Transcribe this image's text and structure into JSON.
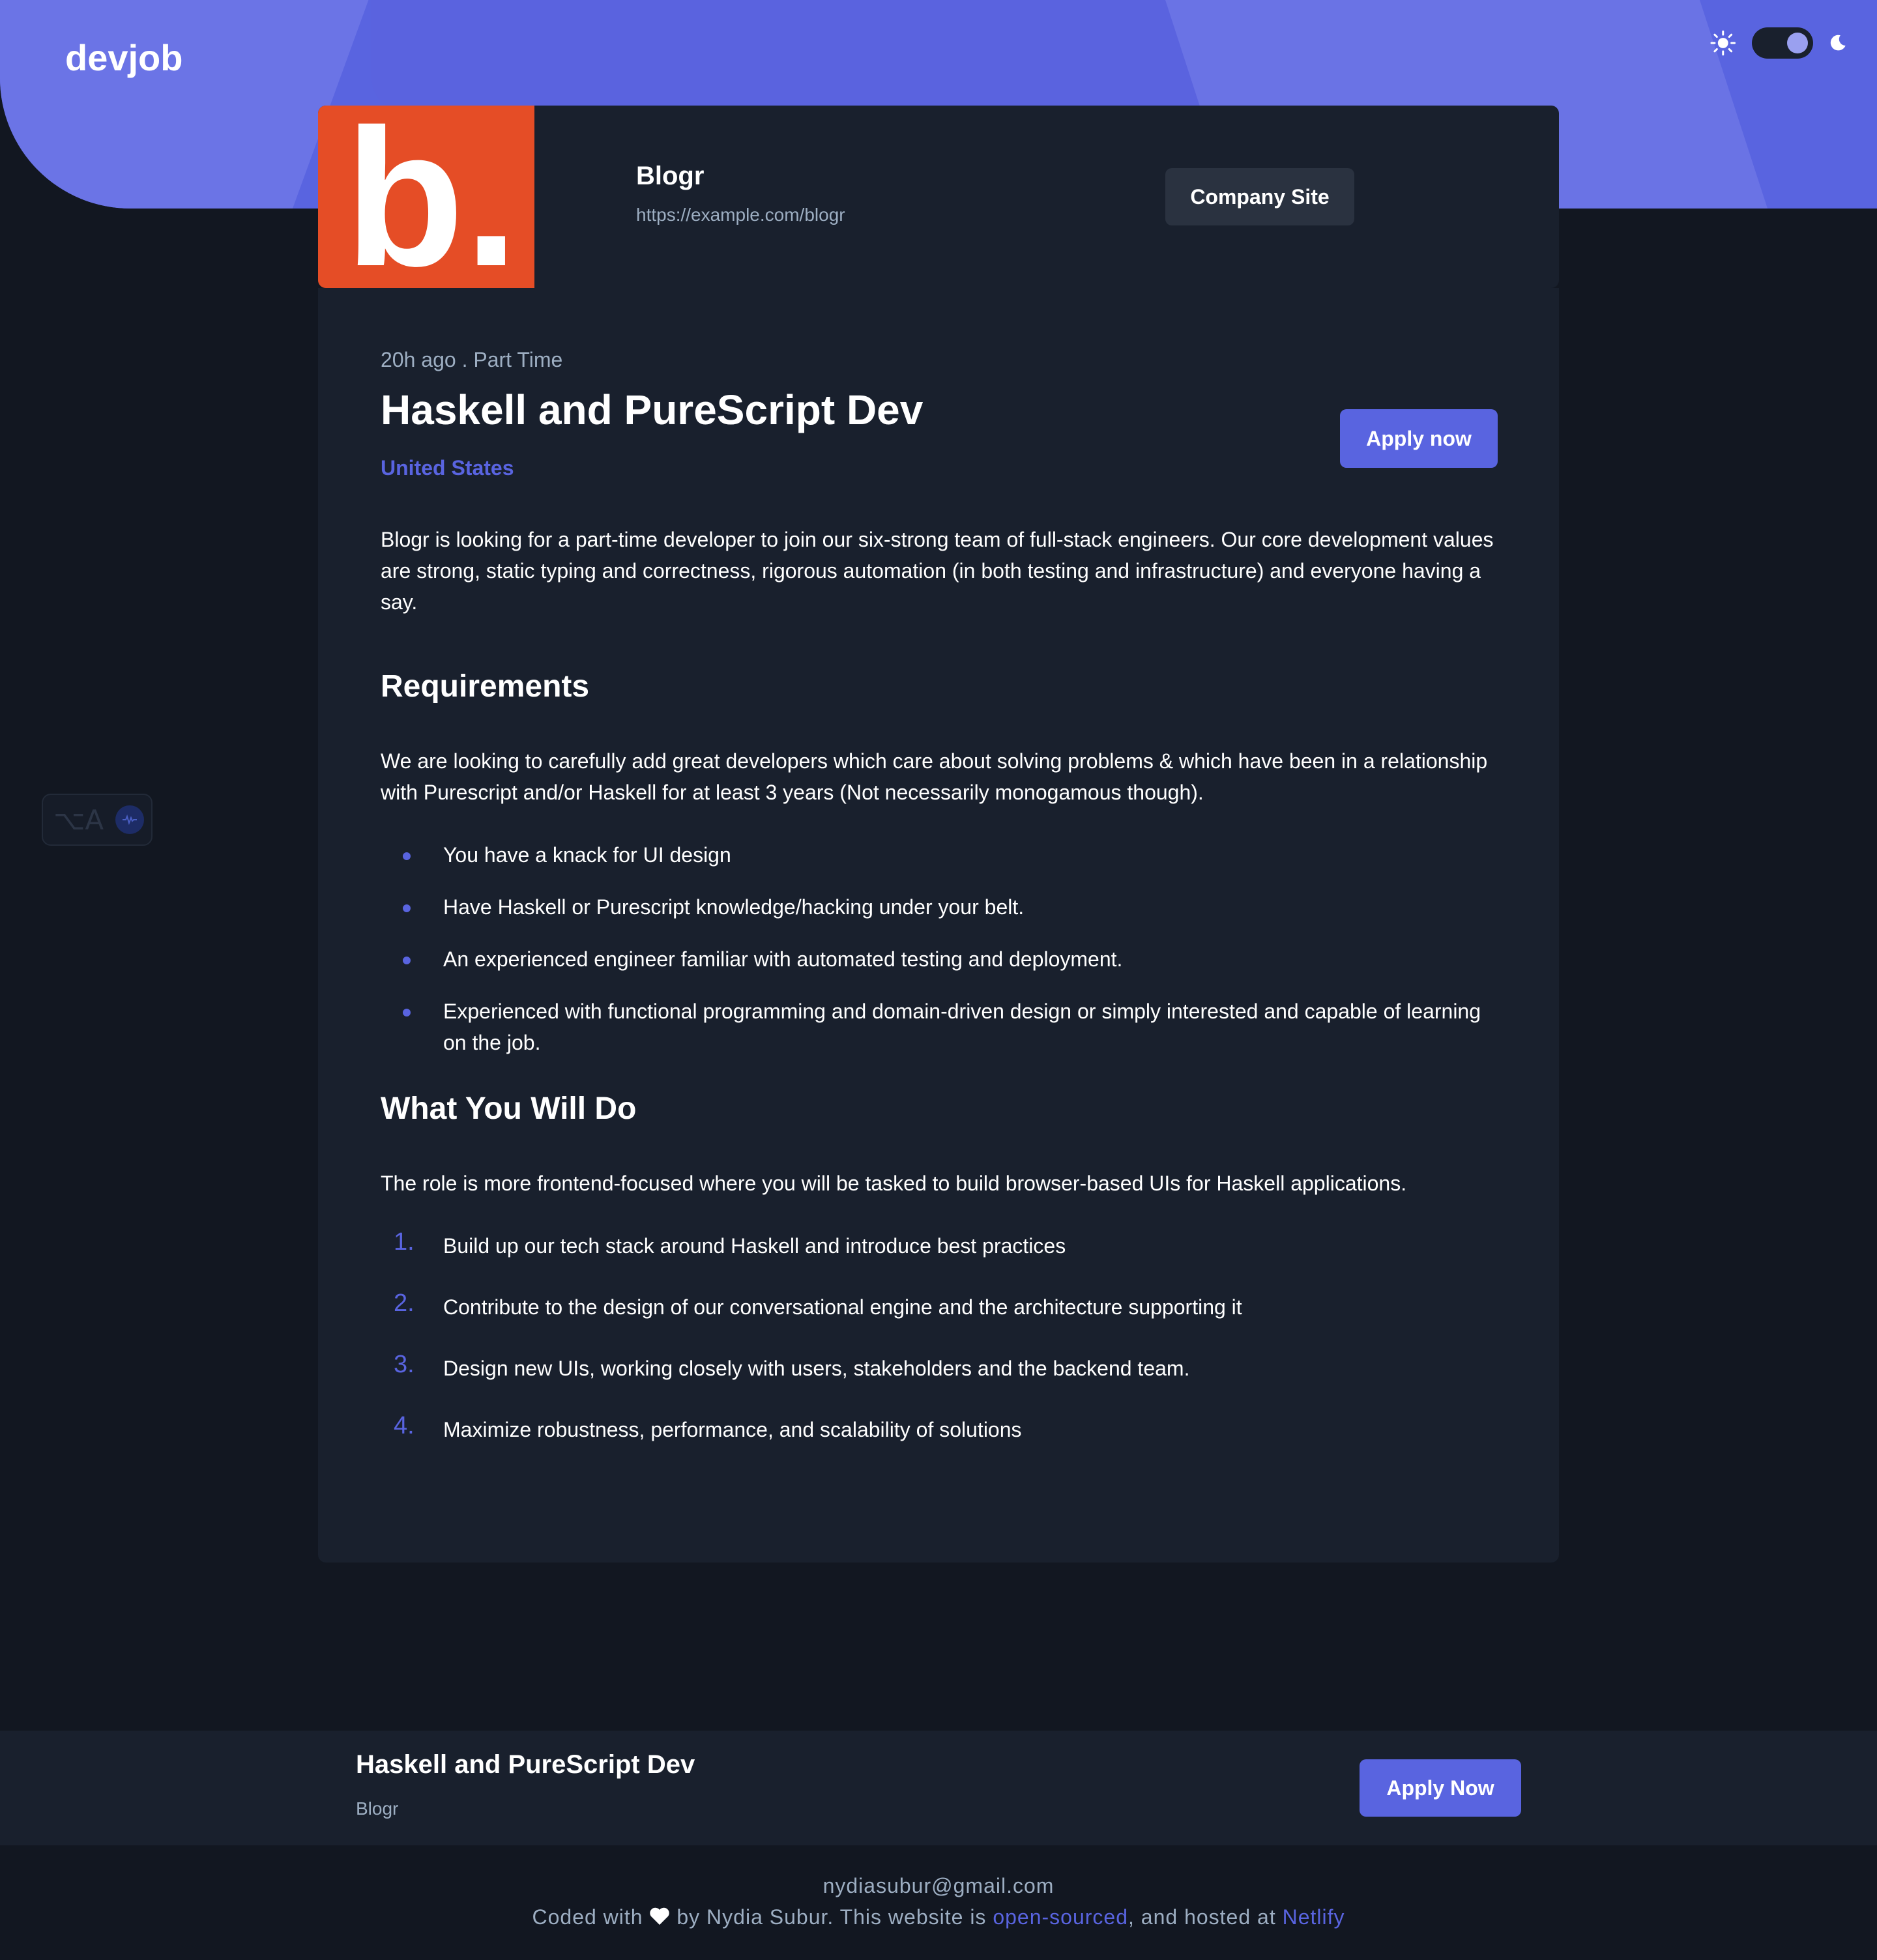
{
  "header": {
    "logo": "devjob",
    "theme": {
      "sun_icon": "sun-icon",
      "moon_icon": "moon-icon",
      "mode": "dark"
    }
  },
  "company": {
    "logo_letter": "b.",
    "logo_color": "#e54d26",
    "name": "Blogr",
    "url": "https://example.com/blogr",
    "site_button": "Company Site"
  },
  "job": {
    "posted": "20h ago",
    "separator": " . ",
    "contract": "Part Time",
    "title": "Haskell and PureScript Dev",
    "location": "United States",
    "apply_label": "Apply now",
    "description": "Blogr is looking for a part-time developer to join our six-strong team of full-stack engineers. Our core development values are strong, static typing and correctness, rigorous automation (in both testing and infrastructure) and everyone having a say.",
    "requirements": {
      "title": "Requirements",
      "content": "We are looking to carefully add great developers which care about solving problems & which have been in a relationship with Purescript and/or Haskell for at least 3 years (Not necessarily monogamous though).",
      "items": [
        "You have a knack for UI design",
        "Have Haskell or Purescript knowledge/hacking under your belt.",
        "An experienced engineer familiar with automated testing and deployment.",
        "Experienced with functional programming and domain-driven design or simply interested and capable of learning on the job."
      ]
    },
    "role": {
      "title": "What You Will Do",
      "content": "The role is more frontend-focused where you will be tasked to build browser-based UIs for Haskell applications.",
      "items": [
        "Build up our tech stack around Haskell and introduce best practices",
        "Contribute to the design of our conversational engine and the architecture supporting it",
        "Design new UIs, working closely with users, stakeholders and the backend team.",
        "Maximize robustness, performance, and scalability of solutions"
      ]
    }
  },
  "side_widget": {
    "keys": "⌥A",
    "icon": "waveform-icon"
  },
  "bottom_bar": {
    "title": "Haskell and PureScript Dev",
    "company": "Blogr",
    "apply_label": "Apply Now"
  },
  "footer": {
    "email": "nydiasubur@gmail.com",
    "text_1": "Coded with",
    "heart_icon": "heart-icon",
    "text_2": " by Nydia Subur. This website is ",
    "link_1": "open-sourced",
    "text_3": ", and hosted at ",
    "link_2": "Netlify"
  },
  "colors": {
    "accent": "#5964e0",
    "background": "#121721",
    "card": "#19202d",
    "muted_text": "#9daec2"
  }
}
